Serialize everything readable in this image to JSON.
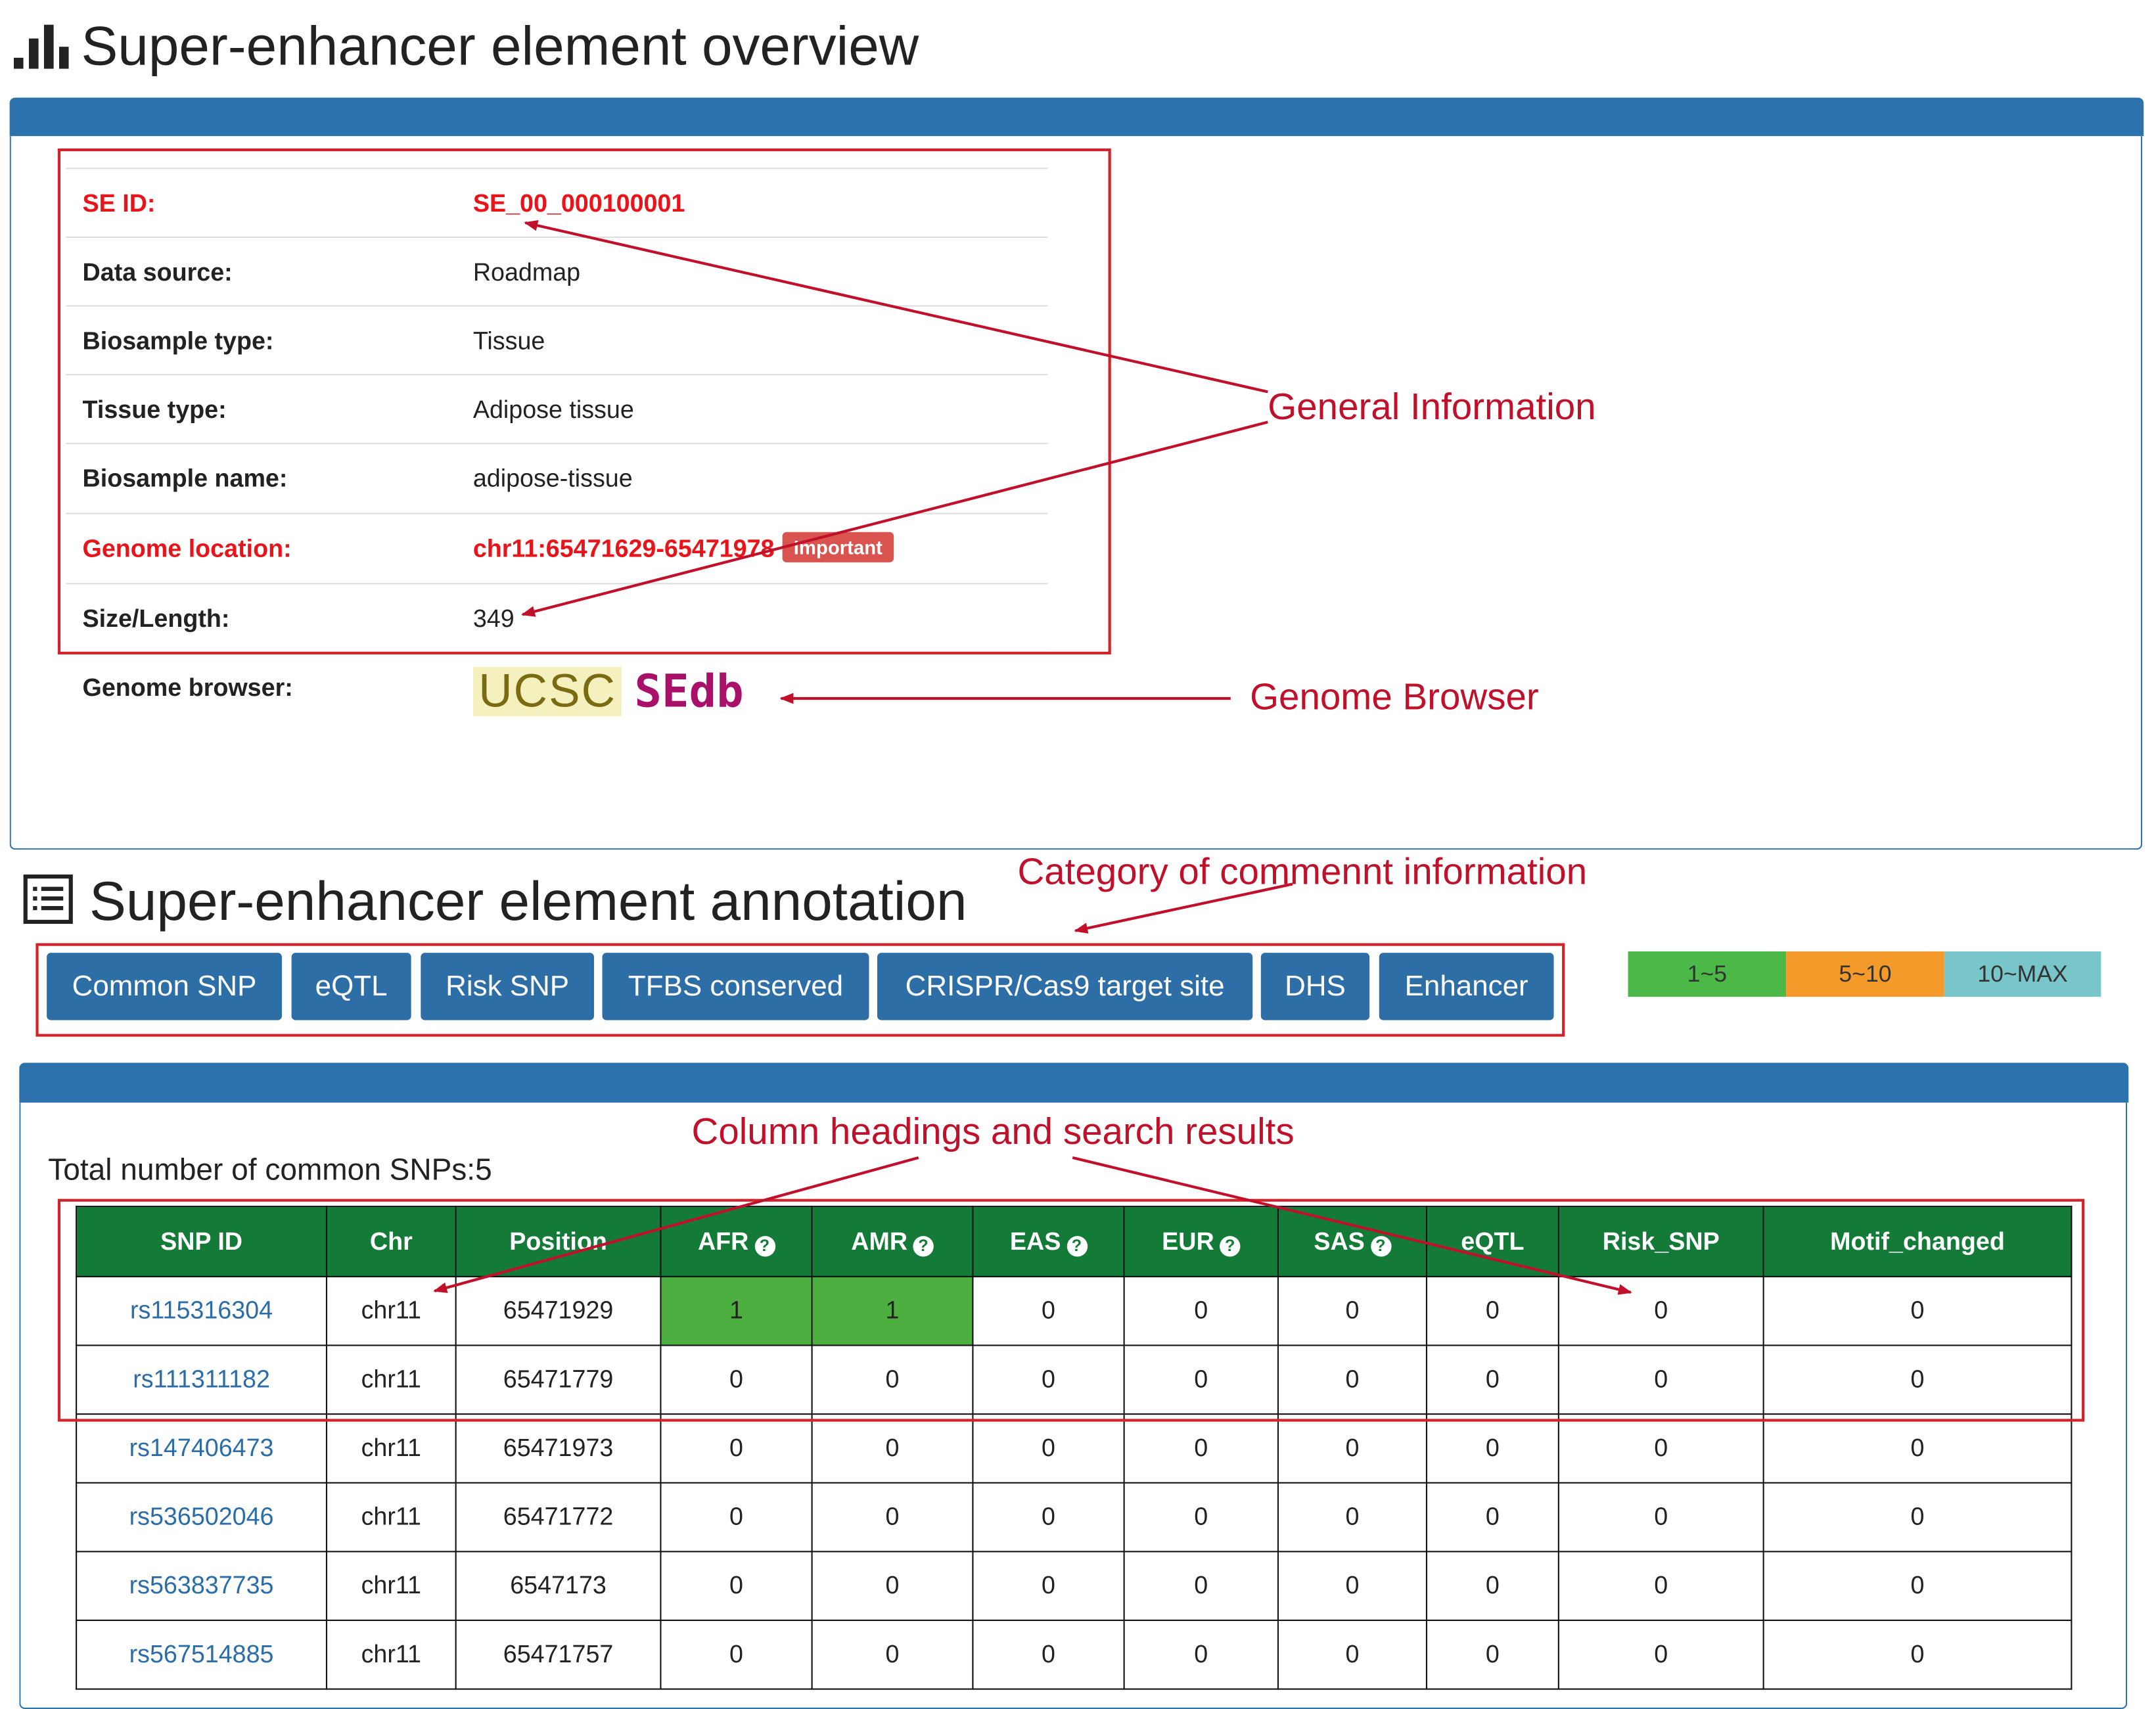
{
  "overview": {
    "title": "Super-enhancer element overview",
    "rows": [
      {
        "label": "SE ID:",
        "value": "SE_00_000100001"
      },
      {
        "label": "Data source:",
        "value": "Roadmap"
      },
      {
        "label": "Biosample type:",
        "value": "Tissue"
      },
      {
        "label": "Tissue type:",
        "value": "Adipose tissue"
      },
      {
        "label": "Biosample name:",
        "value": "adipose-tissue"
      },
      {
        "label": "Genome location:",
        "value": "chr11:65471629-65471978",
        "badge": "Important"
      },
      {
        "label": "Size/Length:",
        "value": "349"
      }
    ],
    "browser_label": "Genome browser:",
    "browser_links": [
      "UCSC",
      "SEdb"
    ]
  },
  "annotation": {
    "title": "Super-enhancer element annotation",
    "categories": [
      "Common SNP",
      "eQTL",
      "Risk SNP",
      "TFBS conserved",
      "CRISPR/Cas9 target site",
      "DHS",
      "Enhancer"
    ],
    "legend": [
      {
        "label": "1~5",
        "color": "#4cb847"
      },
      {
        "label": "5~10",
        "color": "#f39a2b"
      },
      {
        "label": "10~MAX",
        "color": "#78c6c9"
      }
    ],
    "total_text": "Total number of common SNPs:5",
    "columns": [
      "SNP ID",
      "Chr",
      "Position",
      "AFR",
      "AMR",
      "EAS",
      "EUR",
      "SAS",
      "eQTL",
      "Risk_SNP",
      "Motif_changed"
    ],
    "rows": [
      [
        "rs115316304",
        "chr11",
        "65471929",
        "1",
        "1",
        "0",
        "0",
        "0",
        "0",
        "0",
        "0"
      ],
      [
        "rs111311182",
        "chr11",
        "65471779",
        "0",
        "0",
        "0",
        "0",
        "0",
        "0",
        "0",
        "0"
      ],
      [
        "rs147406473",
        "chr11",
        "65471973",
        "0",
        "0",
        "0",
        "0",
        "0",
        "0",
        "0",
        "0"
      ],
      [
        "rs536502046",
        "chr11",
        "65471772",
        "0",
        "0",
        "0",
        "0",
        "0",
        "0",
        "0",
        "0"
      ],
      [
        "rs563837735",
        "chr11",
        "6547173",
        "0",
        "0",
        "0",
        "0",
        "0",
        "0",
        "0",
        "0"
      ],
      [
        "rs567514885",
        "chr11",
        "65471757",
        "0",
        "0",
        "0",
        "0",
        "0",
        "0",
        "0",
        "0"
      ]
    ]
  },
  "annotations": {
    "general": "General Information",
    "browser": "Genome Browser",
    "category": "Category of commennt information",
    "columns": "Column headings and search results"
  },
  "colors": {
    "panel_blue": "#2c72ac",
    "button_blue": "#2e6ea6",
    "header_green": "#147a37",
    "cell_green": "#4caf3f",
    "label_red": "#e8141a",
    "annotation_red": "#c0102a"
  }
}
